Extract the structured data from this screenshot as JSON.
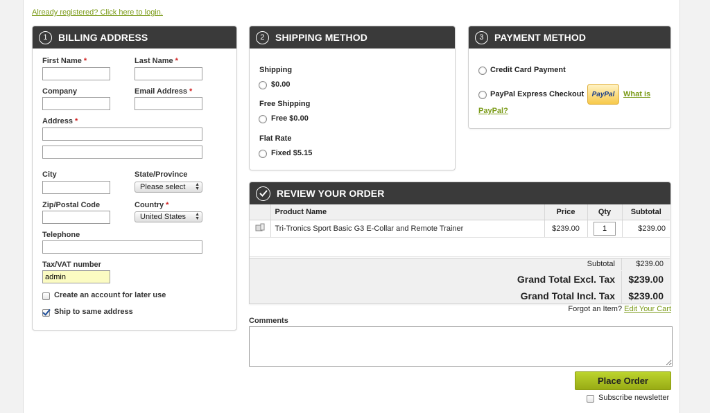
{
  "login_link": "Already registered? Click here to login.",
  "billing": {
    "step": "1",
    "title": "BILLING ADDRESS",
    "first_name_label": "First Name",
    "last_name_label": "Last Name",
    "company_label": "Company",
    "email_label": "Email Address",
    "address_label": "Address",
    "city_label": "City",
    "state_label": "State/Province",
    "state_value": "Please select",
    "zip_label": "Zip/Postal Code",
    "country_label": "Country",
    "country_value": "United States",
    "telephone_label": "Telephone",
    "tax_label": "Tax/VAT number",
    "tax_value": "admin",
    "create_account_label": "Create an account for later use",
    "ship_same_label": "Ship to same address",
    "required_mark": "*"
  },
  "shipping": {
    "step": "2",
    "title": "SHIPPING METHOD",
    "groups": [
      {
        "name": "Shipping",
        "option": "$0.00"
      },
      {
        "name": "Free Shipping",
        "option": "Free $0.00"
      },
      {
        "name": "Flat Rate",
        "option": "Fixed $5.15"
      }
    ]
  },
  "payment": {
    "step": "3",
    "title": "PAYMENT METHOD",
    "credit_card": "Credit Card Payment",
    "paypal": "PayPal Express Checkout",
    "paypal_logo": "PayPal",
    "what_is": "What is",
    "paypal_q": "PayPal?"
  },
  "review": {
    "title": "REVIEW YOUR ORDER",
    "columns": {
      "product": "Product Name",
      "price": "Price",
      "qty": "Qty",
      "subtotal": "Subtotal"
    },
    "items": [
      {
        "name": "Tri-Tronics Sport Basic G3 E-Collar and Remote Trainer",
        "price": "$239.00",
        "qty": "1",
        "subtotal": "$239.00"
      }
    ],
    "subtotal_label": "Subtotal",
    "subtotal_value": "$239.00",
    "grand_excl_label": "Grand Total Excl. Tax",
    "grand_excl_value": "$239.00",
    "grand_incl_label": "Grand Total Incl. Tax",
    "grand_incl_value": "$239.00",
    "forgot_text": "Forgot an Item?",
    "edit_cart": "Edit Your Cart"
  },
  "comments_label": "Comments",
  "place_order": "Place Order",
  "subscribe": "Subscribe newsletter"
}
